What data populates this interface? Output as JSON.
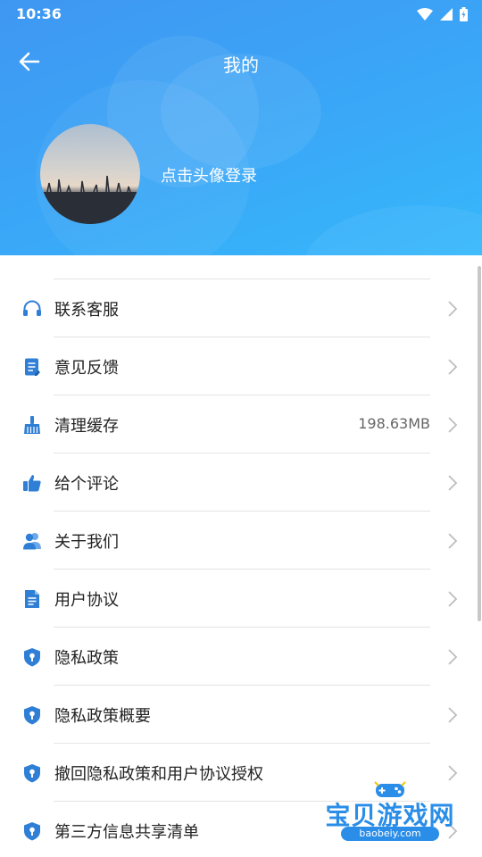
{
  "status_bar": {
    "time": "10:36"
  },
  "header": {
    "title": "我的",
    "login_prompt": "点击头像登录"
  },
  "menu": [
    {
      "label": "联系客服",
      "icon": "headset-icon"
    },
    {
      "label": "意见反馈",
      "icon": "feedback-note-icon"
    },
    {
      "label": "清理缓存",
      "icon": "broom-icon",
      "value": "198.63MB"
    },
    {
      "label": "给个评论",
      "icon": "thumbs-up-icon"
    },
    {
      "label": "关于我们",
      "icon": "people-icon"
    },
    {
      "label": "用户协议",
      "icon": "document-icon"
    },
    {
      "label": "隐私政策",
      "icon": "shield-icon"
    },
    {
      "label": "隐私政策概要",
      "icon": "shield-icon"
    },
    {
      "label": "撤回隐私政策和用户协议授权",
      "icon": "shield-icon"
    },
    {
      "label": "第三方信息共享清单",
      "icon": "shield-icon"
    }
  ],
  "watermark": {
    "text": "宝贝游戏网",
    "url": "baobeiy.com"
  },
  "colors": {
    "header_start": "#3f97f2",
    "header_end": "#36b8fb",
    "icon_blue": "#2f7fd6",
    "divider": "#e4e4e4"
  }
}
